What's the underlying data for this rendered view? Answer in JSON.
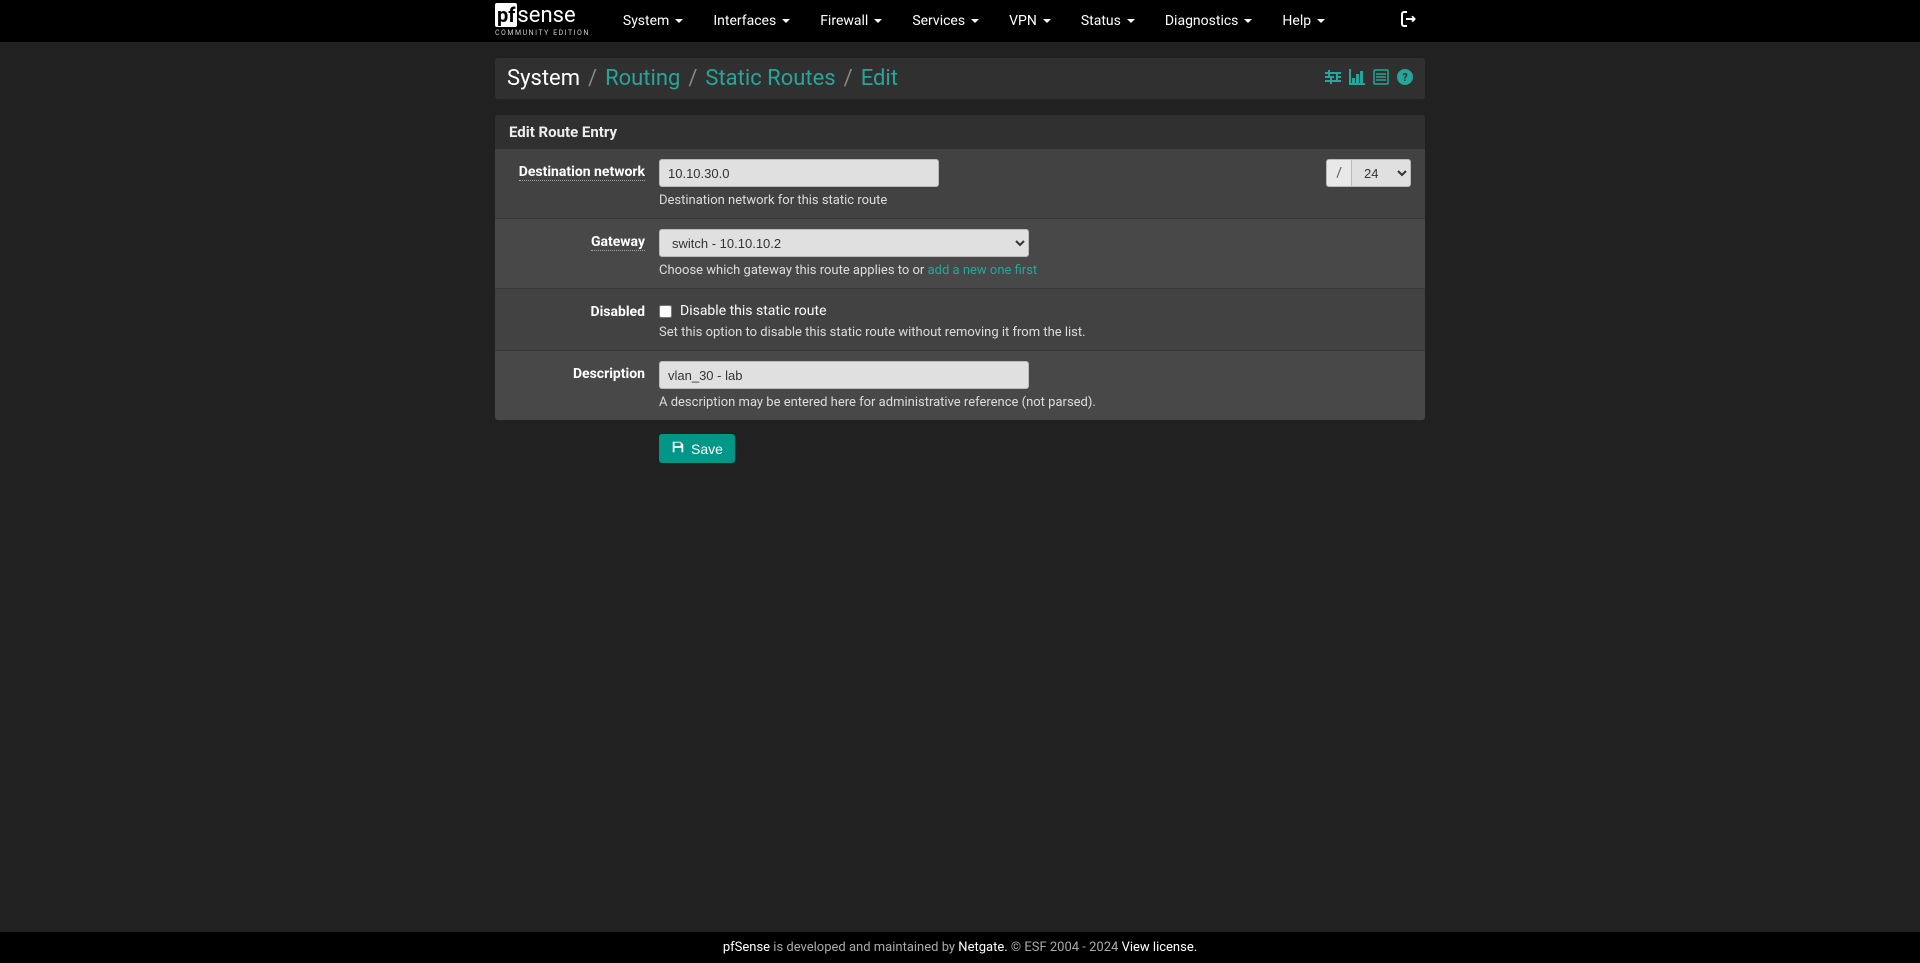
{
  "brand": {
    "name_pf": "pf",
    "name_sense": "sense",
    "edition": "COMMUNITY EDITION"
  },
  "nav": {
    "system": "System",
    "interfaces": "Interfaces",
    "firewall": "Firewall",
    "services": "Services",
    "vpn": "VPN",
    "status": "Status",
    "diagnostics": "Diagnostics",
    "help": "Help"
  },
  "breadcrumb": {
    "system": "System",
    "routing": "Routing",
    "static_routes": "Static Routes",
    "edit": "Edit",
    "sep": "/"
  },
  "panel": {
    "heading": "Edit Route Entry",
    "dest_label": "Destination network",
    "dest_value": "10.10.30.0",
    "dest_slash": "/",
    "dest_cidr": "24",
    "dest_help": "Destination network for this static route",
    "gateway_label": "Gateway",
    "gateway_value": "switch - 10.10.10.2",
    "gateway_help_pre": "Choose which gateway this route applies to or ",
    "gateway_help_link": "add a new one first",
    "disabled_label": "Disabled",
    "disabled_check_label": "Disable this static route",
    "disabled_help": "Set this option to disable this static route without removing it from the list.",
    "description_label": "Description",
    "description_value": "vlan_30 - lab",
    "description_help": "A description may be entered here for administrative reference (not parsed)."
  },
  "buttons": {
    "save": "Save"
  },
  "footer": {
    "pfsense": "pfSense",
    "text1": " is developed and maintained by ",
    "netgate": "Netgate.",
    "text2": " © ESF 2004 - 2024 ",
    "license": "View license."
  }
}
